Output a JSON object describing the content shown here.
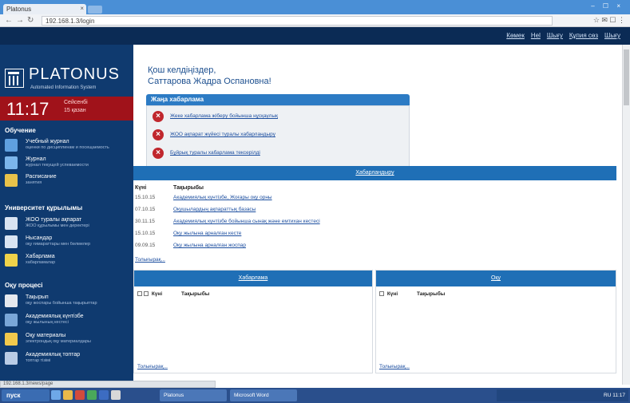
{
  "browser": {
    "tab_title": "Platonus",
    "tab_close": "×",
    "url": "192.168.1.3/login",
    "toolbar_right": "☆ ✉ ☐ ⋮",
    "window_controls": "– ☐ ×"
  },
  "top_links": [
    "Көмек",
    "Hel",
    "Шығу",
    "Құпия сөз",
    "Шығу"
  ],
  "sidebar": {
    "logo_title": "PLATONUS",
    "logo_sub": "Automated Information System",
    "clock_time": "11:17",
    "clock_day": "Сейсенбі",
    "clock_date": "15 қазан",
    "sections": [
      {
        "title": "Обучение",
        "items": [
          {
            "label": "Учебный журнал",
            "desc": "оценки по дисциплинам и посещаемость"
          },
          {
            "label": "Журнал",
            "desc": "журнал текущей успеваемости"
          },
          {
            "label": "Расписание",
            "desc": "занятия"
          }
        ]
      },
      {
        "title": "Университет құрылымы",
        "items": [
          {
            "label": "ЖОО туралы ақпарат",
            "desc": "ЖОО құрылымы мен деректері"
          },
          {
            "label": "Нысандар",
            "desc": "оқу ғимараттары мен бөлмелер"
          },
          {
            "label": "Хабарлама",
            "desc": "хабарламалар"
          }
        ]
      },
      {
        "title": "Оқу процесі",
        "items": [
          {
            "label": "Тақырып",
            "desc": "оқу жоспары бойынша тақырыптар"
          },
          {
            "label": "Академиялық күнтізбе",
            "desc": "оқу жылының кестесі"
          },
          {
            "label": "Оқу материалы",
            "desc": "электрондық оқу материалдары"
          },
          {
            "label": "Академиялық топтар",
            "desc": "топтар тізімі"
          }
        ]
      }
    ]
  },
  "content": {
    "greeting": "Қош келдіңіздер,",
    "name": "Саттарова Жадра Оспановна!",
    "news_title": "Жаңа хабарлама",
    "news_items": [
      "Жеке хабарлама жіберу бойынша нұсқаулық",
      "ЖОО ақпарат жүйесі туралы хабарландыру",
      "Бұйрық туралы хабарлама тексерілді"
    ],
    "announcements_title": "Хабарландыру",
    "columns": {
      "date": "Күні",
      "subject": "Тақырыбы"
    },
    "announcements": [
      {
        "date": "15.10.15",
        "text": "Академиялық күнтізбе, Жоғары оқу орны"
      },
      {
        "date": "07.10.15",
        "text": "Оқушылардың ақпараттық базасы"
      },
      {
        "date": "30.11.15",
        "text": "Академиялық күнтізбе бойынша сынақ және емтихан кестесі"
      },
      {
        "date": "15.10.15",
        "text": "Оқу жылына арналған кесте"
      },
      {
        "date": "09.09.15",
        "text": "Оқу жылына арналған жоспар"
      }
    ],
    "more_label": "Толығырақ...",
    "left_panel_title": "Хабарлама",
    "right_panel_title": "Оқу",
    "left_more": "Толығырақ...",
    "right_more": "Толығырақ..."
  },
  "statusbar": "192.168.1.3/news/page",
  "taskbar": {
    "start_label": "пуск",
    "task1": "Platonus",
    "task2": "Microsoft Word",
    "tray_text": "RU  11:17"
  },
  "colors": {
    "sidebar": "#0f3a6f",
    "clock": "#a0121a",
    "accent": "#1f6fb6",
    "error": "#c0272d"
  }
}
